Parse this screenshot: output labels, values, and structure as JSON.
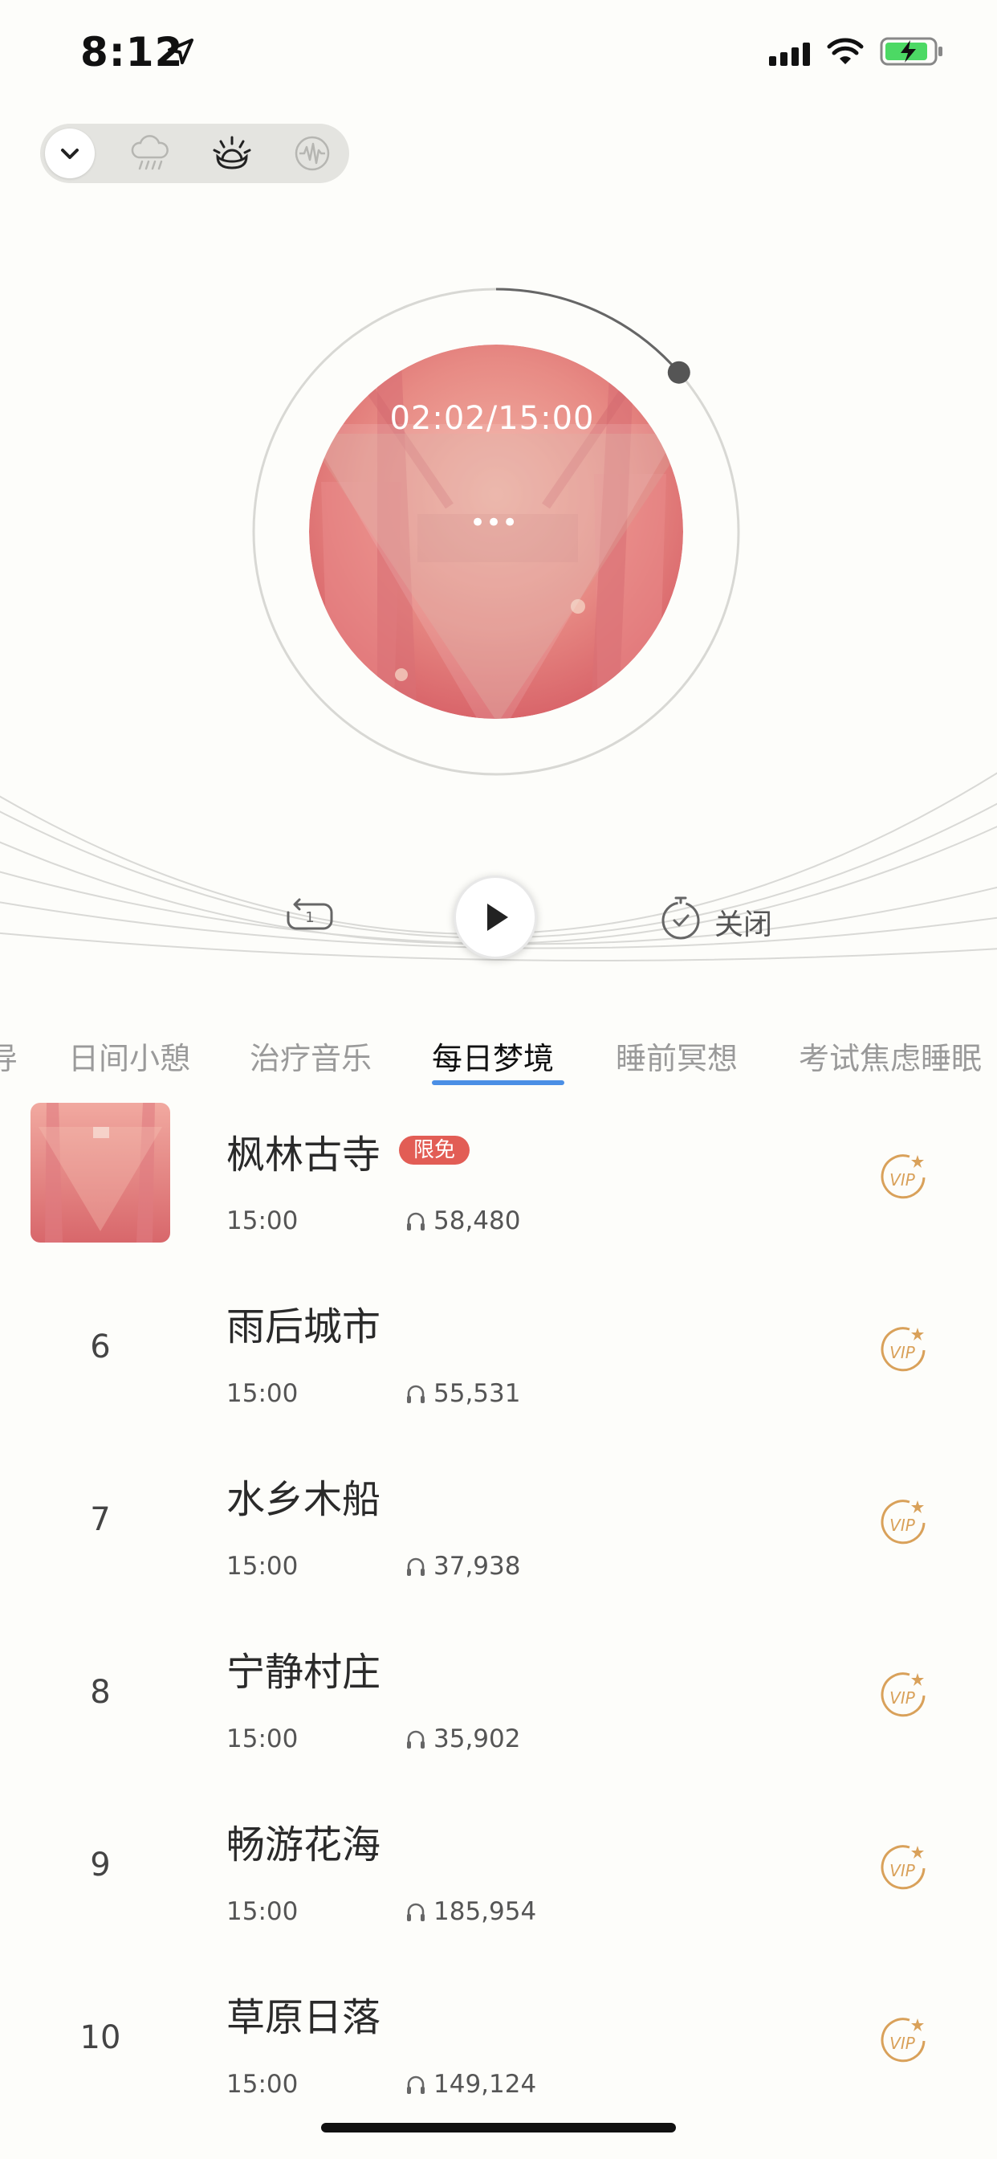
{
  "status_bar": {
    "time": "8:12"
  },
  "player": {
    "time_display": "02:02/15:00",
    "progress_fraction": 0.136,
    "more_label": "•••",
    "timer_label": "关闭"
  },
  "tabs": [
    {
      "label": "导"
    },
    {
      "label": "日间小憩"
    },
    {
      "label": "治疗音乐"
    },
    {
      "label": "每日梦境",
      "active": true
    },
    {
      "label": "睡前冥想"
    },
    {
      "label": "考试焦虑睡眠"
    }
  ],
  "tracks": [
    {
      "title": "枫林古寺",
      "badge": "限免",
      "duration": "15:00",
      "plays": "58,480"
    },
    {
      "number": "6",
      "title": "雨后城市",
      "duration": "15:00",
      "plays": "55,531"
    },
    {
      "number": "7",
      "title": "水乡木船",
      "duration": "15:00",
      "plays": "37,938"
    },
    {
      "number": "8",
      "title": "宁静村庄",
      "duration": "15:00",
      "plays": "35,902"
    },
    {
      "number": "9",
      "title": "畅游花海",
      "duration": "15:00",
      "plays": "185,954"
    },
    {
      "number": "10",
      "title": "草原日落",
      "duration": "15:00",
      "plays": "149,124"
    }
  ],
  "colors": {
    "accent": "#4b8fe5",
    "vip": "#d9a15a",
    "badge": "#e25d55",
    "art": "#e07a78"
  },
  "icons": [
    "location-arrow-icon",
    "signal-icon",
    "wifi-icon",
    "battery-charging-icon",
    "chevron-down-icon",
    "rain-cloud-icon",
    "sunrise-icon",
    "sound-wave-icon",
    "repeat-one-icon",
    "play-icon",
    "timer-icon",
    "headphones-icon",
    "vip-icon"
  ]
}
